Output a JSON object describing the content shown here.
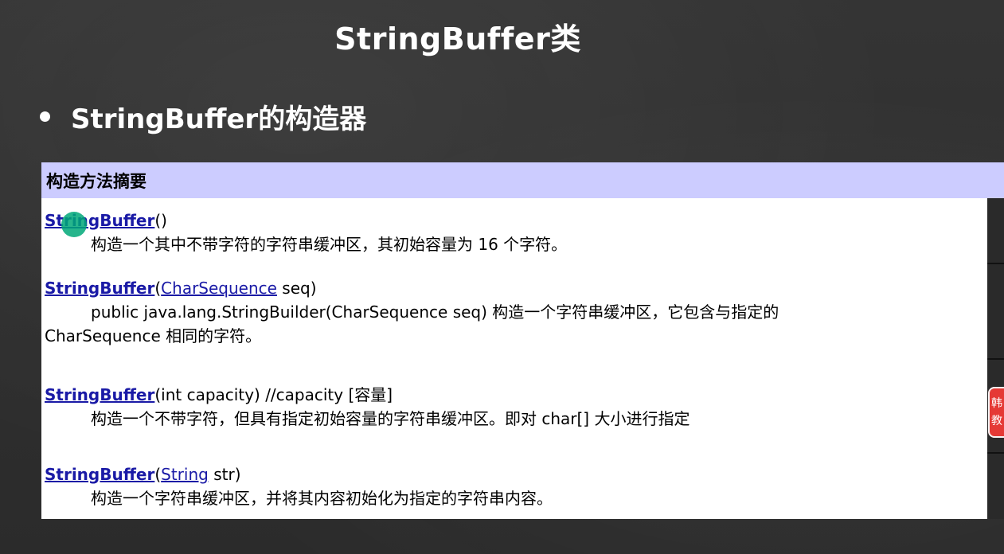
{
  "slide": {
    "title": "StringBuffer类",
    "bullet": "StringBuffer的构造器"
  },
  "doc": {
    "header": "构造方法摘要",
    "entries": [
      {
        "ctor": "StringBuffer",
        "params_before": "()",
        "desc": "构造一个其中不带字符的字符串缓冲区，其初始容量为 16 个字符。"
      },
      {
        "ctor": "StringBuffer",
        "open": "(",
        "param_type": "CharSequence",
        "params_after": " seq)",
        "desc_line1": "public java.lang.StringBuilder(CharSequence seq) 构造一个字符串缓冲区，它包含与指定的",
        "desc_line2": "CharSequence 相同的字符。"
      },
      {
        "ctor": "StringBuffer",
        "params_before": "(int capacity)  //capacity [容量]",
        "desc": "构造一个不带字符，但具有指定初始容量的字符串缓冲区。即对 char[] 大小进行指定"
      },
      {
        "ctor": "StringBuffer",
        "open": "(",
        "param_type": "String",
        "params_after": " str)",
        "desc": "构造一个字符串缓冲区，并将其内容初始化为指定的字符串内容。"
      }
    ]
  },
  "side_badge": {
    "line1": "韩",
    "line2": "教"
  },
  "colors": {
    "header_bg": "#ccccff",
    "link": "#1a1aa6",
    "badge": "#e53935",
    "cursor": "#00a878"
  }
}
